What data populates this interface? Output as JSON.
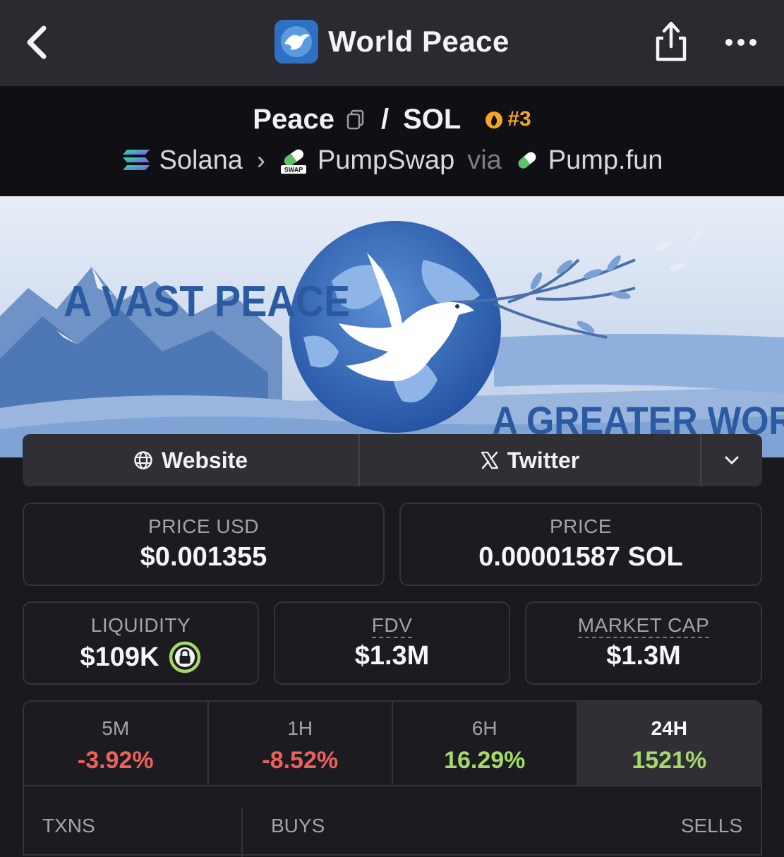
{
  "header": {
    "title": "World Peace",
    "icons": {
      "back": "back-chevron-icon",
      "share": "share-icon",
      "more": "more-dots-icon"
    }
  },
  "pair": {
    "base": "Peace",
    "quote": "SOL",
    "separator": "/",
    "rank": "#3",
    "chain": "Solana",
    "dex": "PumpSwap",
    "via_label": "via",
    "launchpad": "Pump.fun"
  },
  "banner": {
    "text_left": "A VAST PEACE",
    "text_right": "A GREATER WORLD"
  },
  "links": {
    "website": "Website",
    "twitter": "Twitter"
  },
  "stats": {
    "price_usd_label": "PRICE USD",
    "price_usd": "$0.001355",
    "price_label": "PRICE",
    "price": "0.00001587 SOL",
    "liquidity_label": "LIQUIDITY",
    "liquidity": "$109K",
    "fdv_label": "FDV",
    "fdv": "$1.3M",
    "mcap_label": "MARKET CAP",
    "mcap": "$1.3M"
  },
  "timeframes": [
    {
      "label": "5M",
      "change": "-3.92%",
      "direction": "down"
    },
    {
      "label": "1H",
      "change": "-8.52%",
      "direction": "down"
    },
    {
      "label": "6H",
      "change": "16.29%",
      "direction": "up"
    },
    {
      "label": "24H",
      "change": "1521%",
      "direction": "up",
      "active": true
    }
  ],
  "txns": {
    "txns_label": "TXNS",
    "buys_label": "BUYS",
    "sells_label": "SELLS"
  },
  "colors": {
    "negative": "#f0605b",
    "positive": "#a6d96a",
    "rank": "#f5a524",
    "lock": "#a6d96a"
  }
}
